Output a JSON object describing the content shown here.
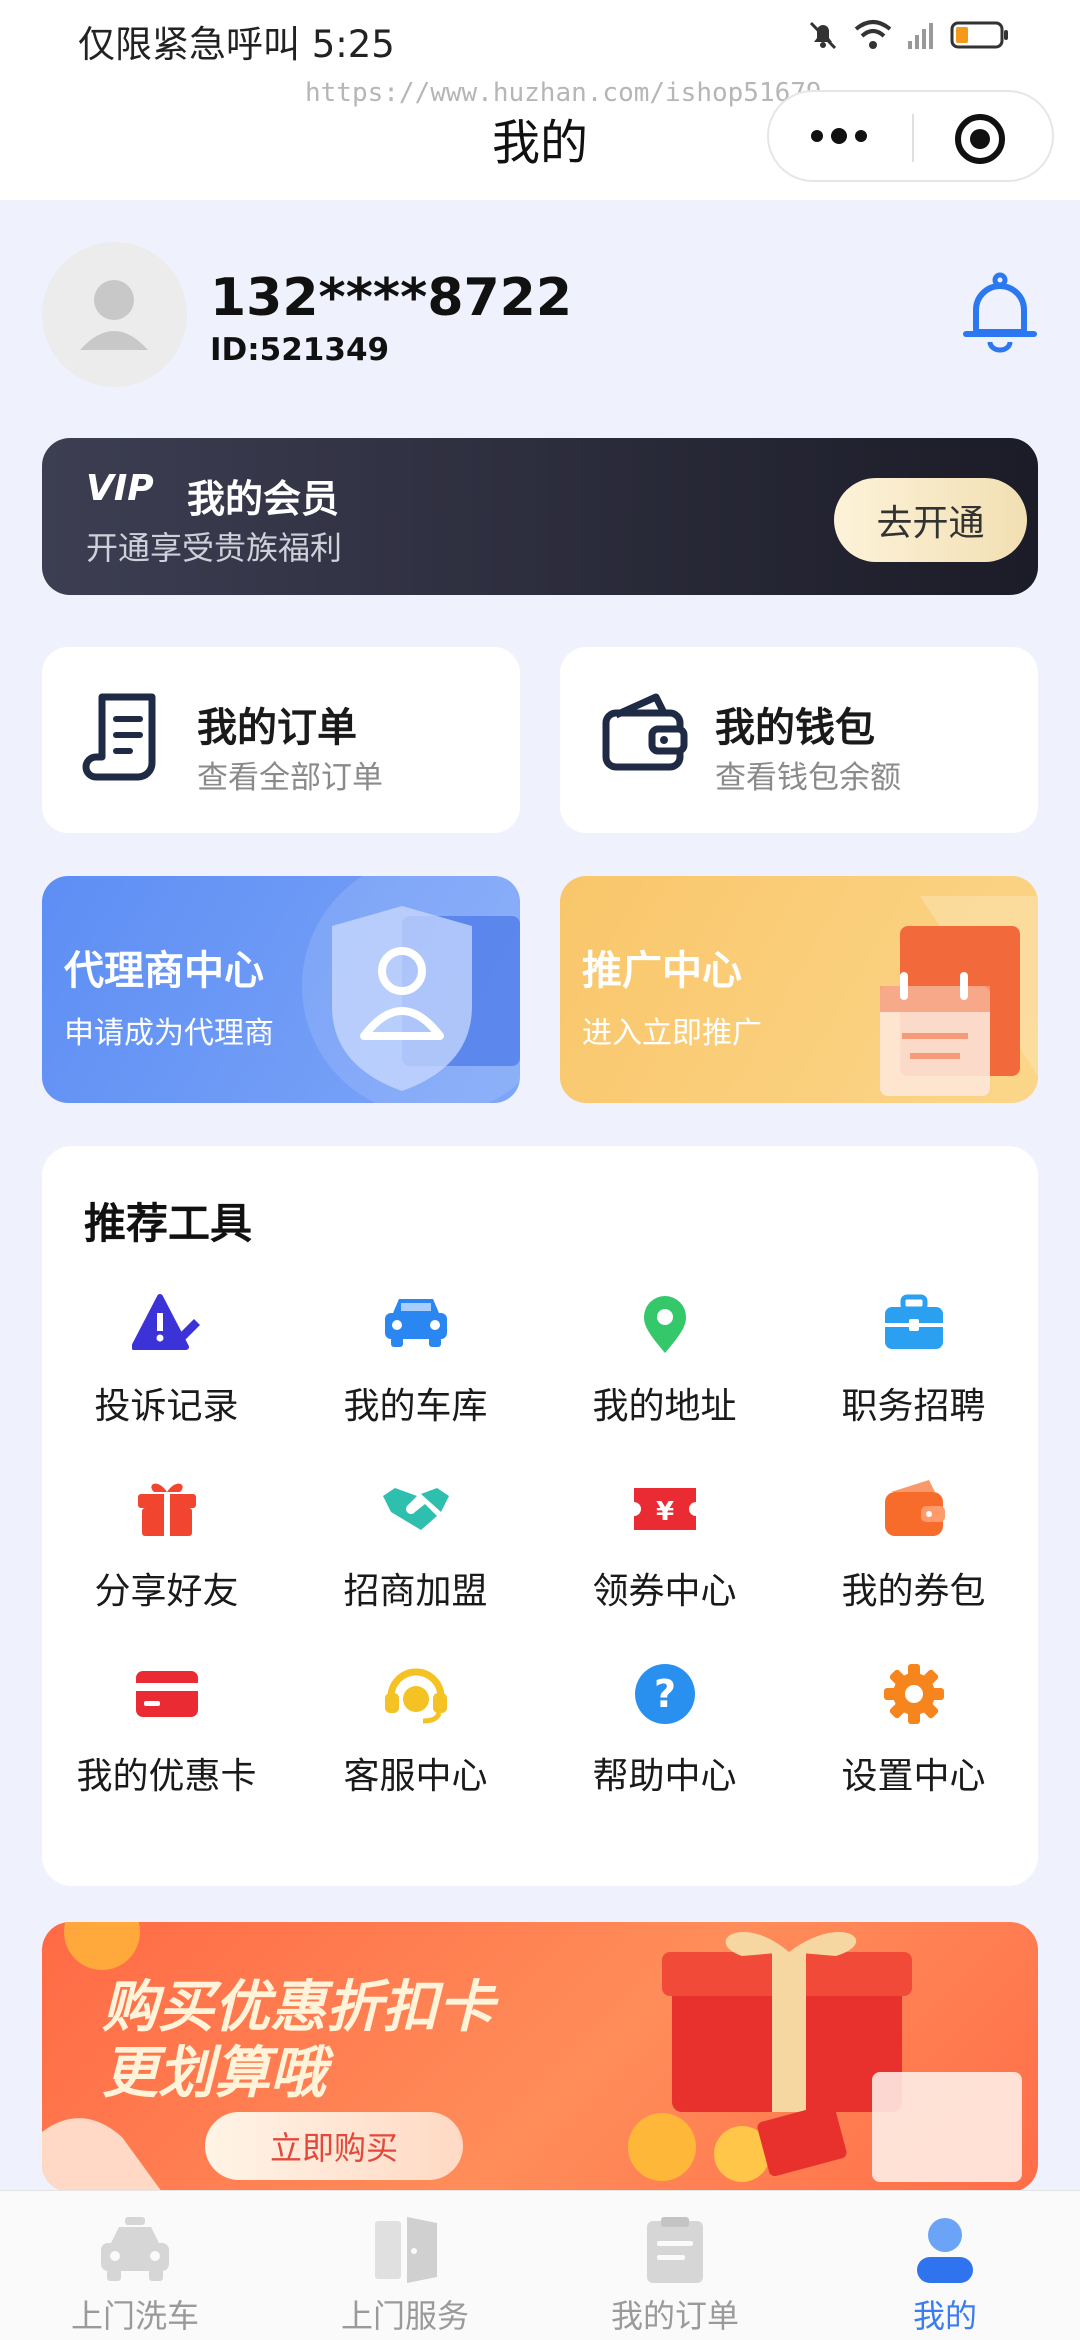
{
  "status_bar": {
    "text": "仅限紧急呼叫 5:25"
  },
  "watermark": "https://www.huzhan.com/ishop51679",
  "nav": {
    "title": "我的"
  },
  "user": {
    "phone": "132****8722",
    "id": "ID:521349"
  },
  "vip": {
    "logo": "VIP",
    "title": "我的会员",
    "subtitle": "开通享受贵族福利",
    "button": "去开通"
  },
  "cards": {
    "order": {
      "title": "我的订单",
      "subtitle": "查看全部订单"
    },
    "wallet": {
      "title": "我的钱包",
      "subtitle": "查看钱包余额"
    }
  },
  "tiles": {
    "agent": {
      "title": "代理商中心",
      "subtitle": "申请成为代理商"
    },
    "promo": {
      "title": "推广中心",
      "subtitle": "进入立即推广"
    }
  },
  "tools": {
    "title": "推荐工具",
    "items": [
      {
        "label": "投诉记录",
        "icon": "warning-icon"
      },
      {
        "label": "我的车库",
        "icon": "car-icon"
      },
      {
        "label": "我的地址",
        "icon": "location-pin-icon"
      },
      {
        "label": "职务招聘",
        "icon": "briefcase-icon"
      },
      {
        "label": "分享好友",
        "icon": "gift-icon"
      },
      {
        "label": "招商加盟",
        "icon": "handshake-icon"
      },
      {
        "label": "领券中心",
        "icon": "coupon-icon"
      },
      {
        "label": "我的券包",
        "icon": "wallet-icon"
      },
      {
        "label": "我的优惠卡",
        "icon": "card-icon"
      },
      {
        "label": "客服中心",
        "icon": "headset-icon"
      },
      {
        "label": "帮助中心",
        "icon": "help-icon"
      },
      {
        "label": "设置中心",
        "icon": "gear-icon"
      }
    ]
  },
  "banner": {
    "line1": "购买优惠折扣卡",
    "line2": "更划算哦",
    "button": "立即购买"
  },
  "tabbar": {
    "items": [
      {
        "label": "上门洗车",
        "icon": "car-wash-icon"
      },
      {
        "label": "上门服务",
        "icon": "door-icon"
      },
      {
        "label": "我的订单",
        "icon": "clipboard-icon"
      },
      {
        "label": "我的",
        "icon": "person-icon"
      }
    ],
    "active": 3
  },
  "colors": {
    "accent": "#3b7cf0",
    "background": "#eff2fc",
    "vip_dark": "#2a2b3a",
    "agent_blue": "#6a97f6",
    "promo_orange": "#f9c66a",
    "banner_red": "#ff6a45"
  }
}
